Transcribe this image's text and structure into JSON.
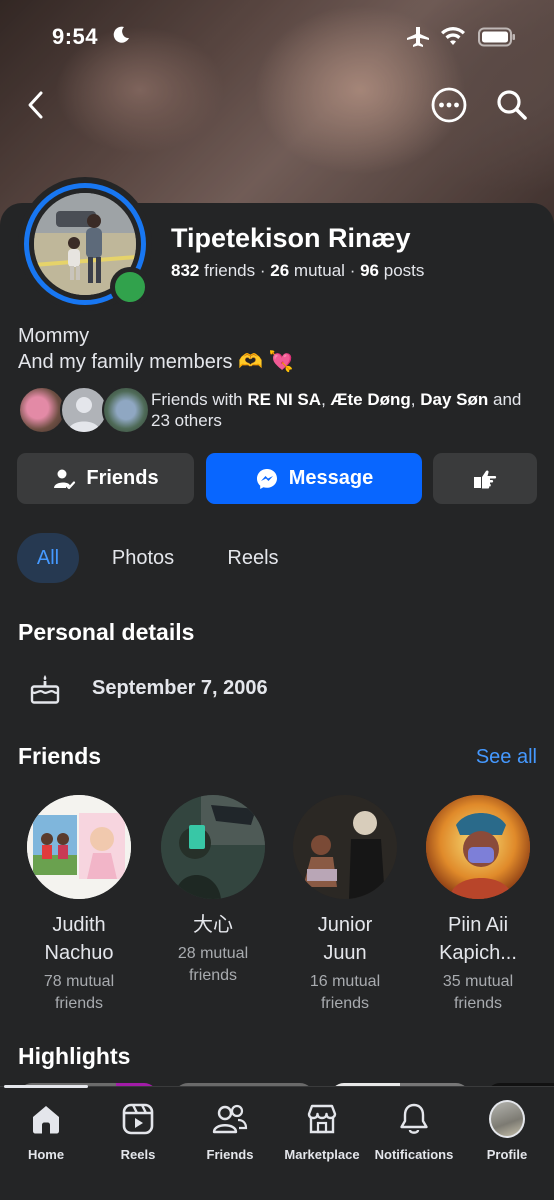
{
  "status_bar": {
    "time": "9:54"
  },
  "profile": {
    "name": "Tipetekison Rinæy",
    "friends_count": "832",
    "friends_label": "friends",
    "mutual_count": "26",
    "mutual_label": "mutual",
    "posts_count": "96",
    "posts_label": "posts",
    "bio_line1": "Mommy",
    "bio_line2": "And my family members 🫶 💘",
    "online": true
  },
  "mutual_friends": {
    "prefix": "Friends with ",
    "names": [
      "RE NI SA",
      "Æte Døng",
      "Day Søn"
    ],
    "sep1": ", ",
    "sep2": ", ",
    "suffix": " and 23 others"
  },
  "actions": {
    "friends_label": "Friends",
    "message_label": "Message"
  },
  "tabs": [
    {
      "label": "All",
      "active": true
    },
    {
      "label": "Photos",
      "active": false
    },
    {
      "label": "Reels",
      "active": false
    }
  ],
  "personal_details": {
    "title": "Personal details",
    "birthday": "September 7, 2006"
  },
  "friends": {
    "title": "Friends",
    "see_all": "See all",
    "items": [
      {
        "name_line1": "Judith",
        "name_line2": "Nachuo",
        "mutual_line1": "78 mutual",
        "mutual_line2": "friends"
      },
      {
        "name_line1": "大心",
        "name_line2": "",
        "mutual_line1": "28 mutual",
        "mutual_line2": "friends"
      },
      {
        "name_line1": "Junior",
        "name_line2": "Juun",
        "mutual_line1": "16 mutual",
        "mutual_line2": "friends"
      },
      {
        "name_line1": "Piin Aii",
        "name_line2": "Kapich...",
        "mutual_line1": "35 mutual",
        "mutual_line2": "friends"
      }
    ]
  },
  "highlights": {
    "title": "Highlights"
  },
  "bottom_nav": [
    {
      "label": "Home",
      "icon": "home-icon",
      "active": true
    },
    {
      "label": "Reels",
      "icon": "reels-icon",
      "active": false
    },
    {
      "label": "Friends",
      "icon": "friends-icon",
      "active": false
    },
    {
      "label": "Marketplace",
      "icon": "marketplace-icon",
      "active": false
    },
    {
      "label": "Notifications",
      "icon": "bell-icon",
      "active": false
    },
    {
      "label": "Profile",
      "icon": "profile-avatar",
      "active": false
    }
  ],
  "colors": {
    "accent": "#0866ff",
    "link": "#4599ff",
    "online": "#31a24c",
    "background": "#242526",
    "button_secondary": "#3a3b3c"
  }
}
